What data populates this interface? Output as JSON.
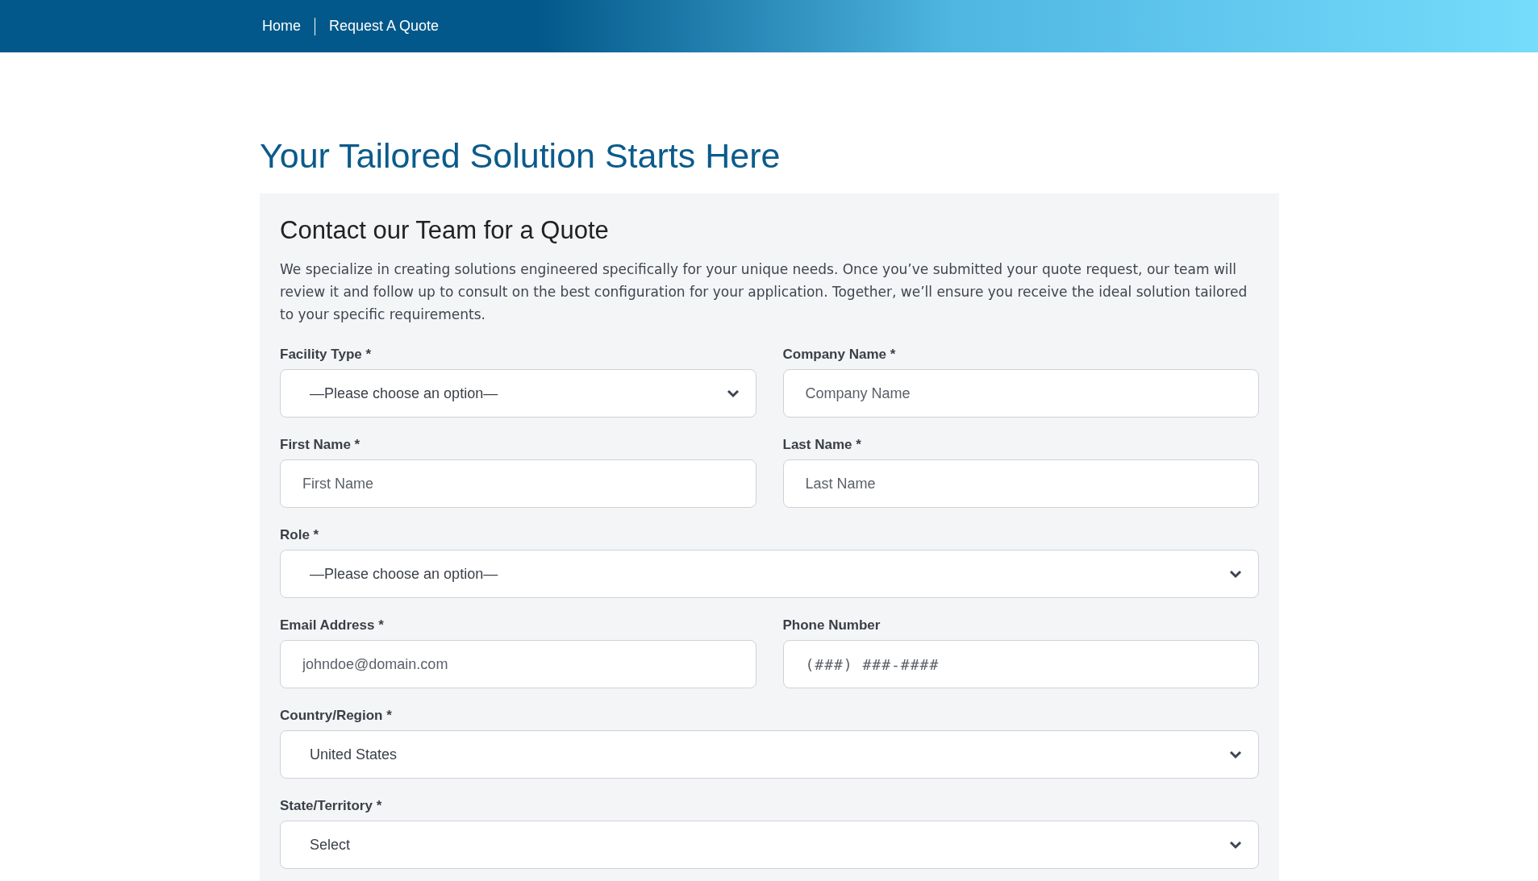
{
  "nav": {
    "links": [
      {
        "label": "Home"
      },
      {
        "label": "Request A Quote"
      }
    ]
  },
  "page_title": "Your Tailored Solution Starts Here",
  "form": {
    "heading": "Contact our Team for a Quote",
    "intro": "We specialize in creating solutions engineered specifically for your unique needs. Once you’ve submitted your quote request, our team will review it and follow up to consult on the best configuration for your application. Together, we’ll ensure you receive the ideal solution tailored to your specific requirements.",
    "fields": [
      {
        "label": "Facility Type *",
        "kind": "select",
        "value": "—Please choose an option—",
        "full_width": false
      },
      {
        "label": "Company Name *",
        "kind": "input",
        "placeholder": "Company Name",
        "full_width": false
      },
      {
        "label": "First Name *",
        "kind": "input",
        "placeholder": "First Name",
        "full_width": false
      },
      {
        "label": "Last Name *",
        "kind": "input",
        "placeholder": "Last Name",
        "full_width": false
      },
      {
        "label": "Role *",
        "kind": "select",
        "value": "—Please choose an option—",
        "full_width": true
      },
      {
        "label": "Email Address *",
        "kind": "input",
        "placeholder": "johndoe@domain.com",
        "full_width": false
      },
      {
        "label": "Phone Number",
        "kind": "phone",
        "placeholder": "(###) ###-####",
        "full_width": false
      },
      {
        "label": "Country/Region *",
        "kind": "select",
        "value": "United States",
        "full_width": true
      },
      {
        "label": "State/Territory *",
        "kind": "select",
        "value": "Select",
        "full_width": true
      }
    ]
  }
}
